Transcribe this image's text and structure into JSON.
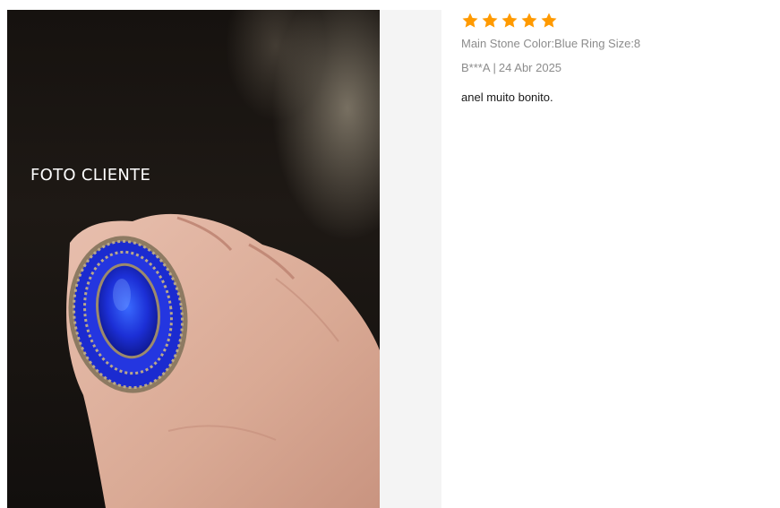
{
  "photo": {
    "caption": "FOTO CLIENTE"
  },
  "review": {
    "rating": 5,
    "rating_max": 5,
    "star_color": "#ff9a00",
    "sku": "Main Stone Color:Blue Ring Size:8",
    "author": "B***A",
    "separator": "|",
    "date": "24 Abr 2025",
    "text": "anel muito bonito."
  }
}
